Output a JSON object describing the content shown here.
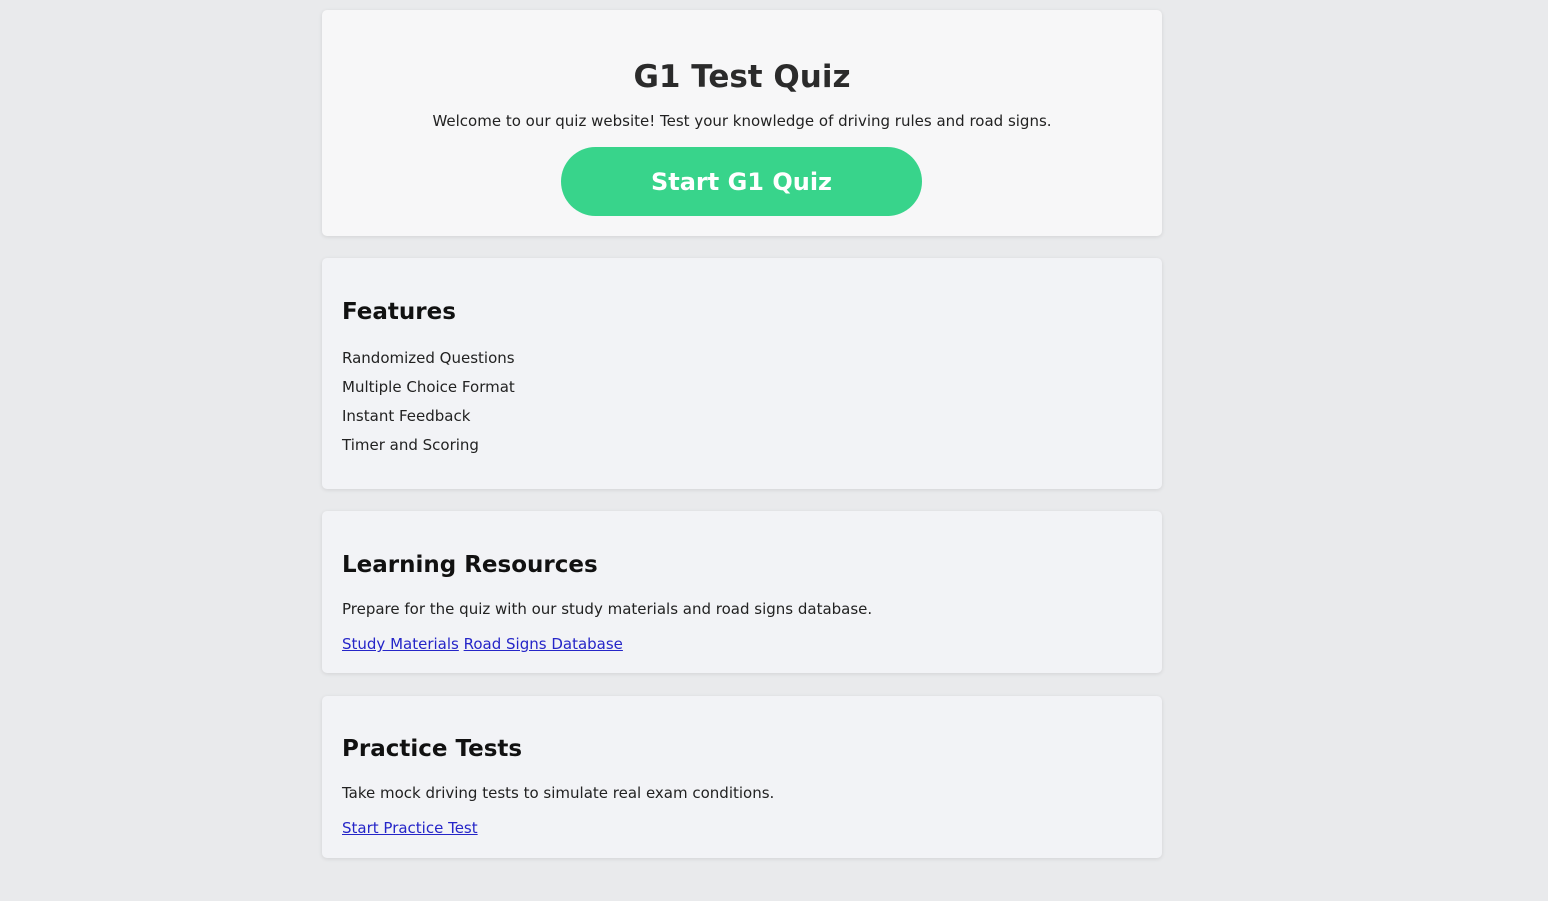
{
  "hero": {
    "title": "G1 Test Quiz",
    "welcome": "Welcome to our quiz website! Test your knowledge of driving rules and road signs.",
    "start_button": "Start G1 Quiz"
  },
  "features": {
    "heading": "Features",
    "items": [
      "Randomized Questions",
      "Multiple Choice Format",
      "Instant Feedback",
      "Timer and Scoring"
    ]
  },
  "resources": {
    "heading": "Learning Resources",
    "description": "Prepare for the quiz with our study materials and road signs database.",
    "links": [
      "Study Materials",
      "Road Signs Database"
    ]
  },
  "practice": {
    "heading": "Practice Tests",
    "description": "Take mock driving tests to simulate real exam conditions.",
    "link": "Start Practice Test"
  },
  "colors": {
    "page_background": "#e9eaec",
    "accent_button": "#38d48b",
    "link": "#2525c8"
  }
}
